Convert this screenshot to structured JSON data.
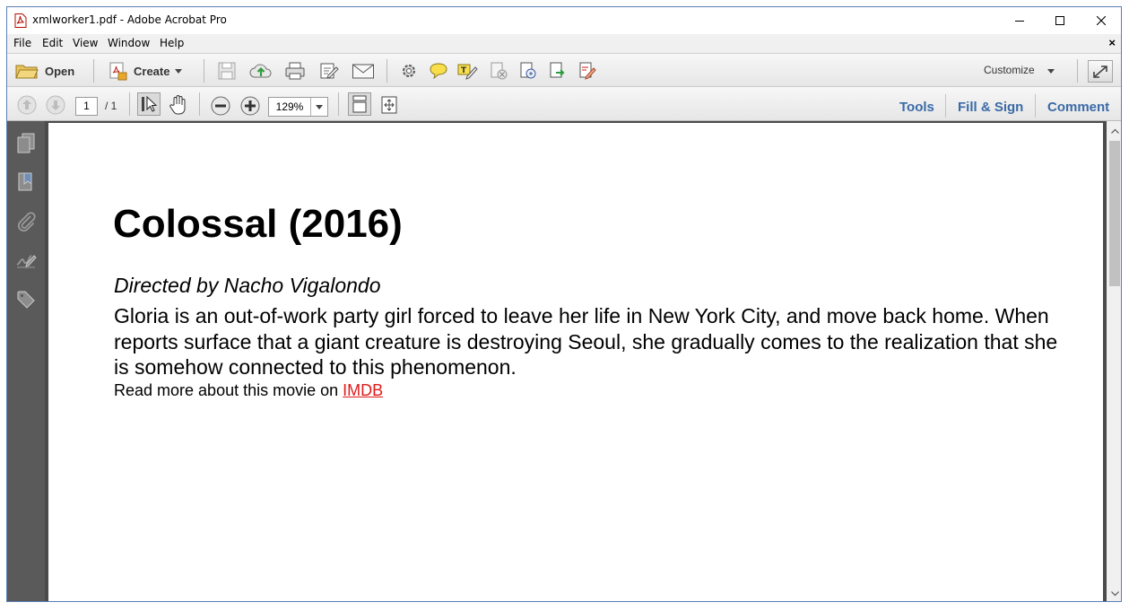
{
  "window": {
    "title": "xmlworker1.pdf - Adobe Acrobat Pro",
    "app_icon": "acrobat-pdf-icon",
    "controls": [
      "minimize-icon",
      "maximize-icon",
      "close-icon"
    ]
  },
  "menu": {
    "items": [
      "File",
      "Edit",
      "View",
      "Window",
      "Help"
    ],
    "close_doc": "×"
  },
  "toolbar": {
    "open_label": "Open",
    "create_label": "Create",
    "customize_label": "Customize",
    "icons": [
      "save-icon",
      "cloud-upload-icon",
      "print-icon",
      "edit-icon",
      "email-icon",
      "settings-icon",
      "comment-icon",
      "highlight-icon",
      "attach-icon",
      "stamp-icon",
      "export-icon",
      "sign-icon"
    ]
  },
  "navbar": {
    "page_current": "1",
    "page_total": "/ 1",
    "zoom": "129%",
    "tools_label": "Tools",
    "fill_sign_label": "Fill & Sign",
    "comment_label": "Comment"
  },
  "sidebar": {
    "icons": [
      "pages-icon",
      "bookmark-icon",
      "attachment-icon",
      "signature-icon",
      "tag-icon"
    ]
  },
  "document": {
    "heading": "Colossal (2016)",
    "director": "Directed by Nacho Vigalondo",
    "synopsis": "Gloria is an out-of-work party girl forced to leave her life in New York City, and move back home. When reports surface that a giant creature is destroying Seoul, she gradually comes to the realization that she is somehow connected to this phenomenon.",
    "read_more": "Read more about this movie on ",
    "link_text": "IMDB",
    "link_color": "#e21a1a"
  },
  "colors": {
    "accent": "#3a6aa7",
    "sidebar_bg": "#5a5a5a",
    "doc_bg": "#4b4b4b"
  }
}
